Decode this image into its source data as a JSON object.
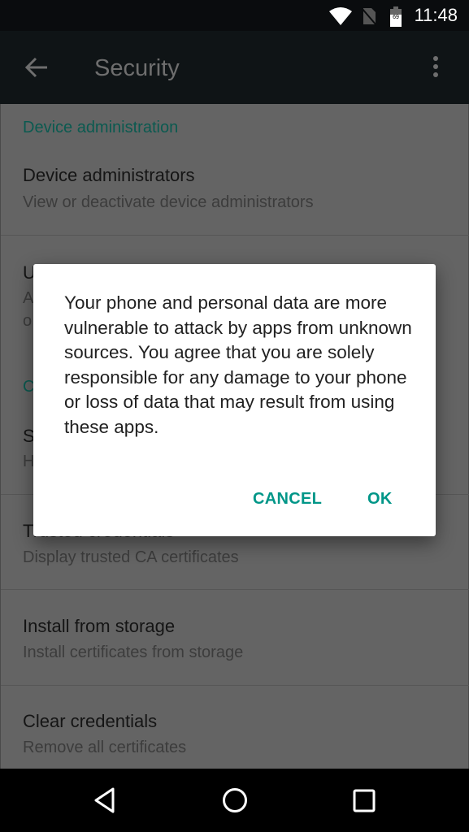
{
  "status_bar": {
    "time": "11:48",
    "battery_level": "69",
    "icons": [
      "wifi-icon",
      "no-sim-icon",
      "battery-icon"
    ]
  },
  "app_bar": {
    "title": "Security",
    "back_icon": "arrow-left-icon",
    "menu_icon": "more-vert-icon"
  },
  "list": {
    "section_device_admin": "Device administration",
    "device_admins": {
      "title": "Device administrators",
      "subtitle": "View or deactivate device administrators"
    },
    "partial_fragments": [
      "U",
      "A",
      "o",
      "C",
      "S",
      "H"
    ],
    "trusted": {
      "title": "Trusted credentials",
      "subtitle": "Display trusted CA certificates"
    },
    "install": {
      "title": "Install from storage",
      "subtitle": "Install certificates from storage"
    },
    "clear": {
      "title": "Clear credentials",
      "subtitle": "Remove all certificates"
    }
  },
  "dialog": {
    "message": "Your phone and personal data are more vulnerable to attack by apps from unknown sources. You agree that you are solely responsible for any damage to your phone or loss of data that may result from using these apps.",
    "cancel_label": "CANCEL",
    "ok_label": "OK"
  },
  "colors": {
    "accent": "#009688",
    "section_header_dimmed": "#0b5a50",
    "scrim_bg": "#646464"
  },
  "nav_bar": {
    "icons": [
      "back-triangle-icon",
      "home-circle-icon",
      "recents-square-icon"
    ]
  }
}
